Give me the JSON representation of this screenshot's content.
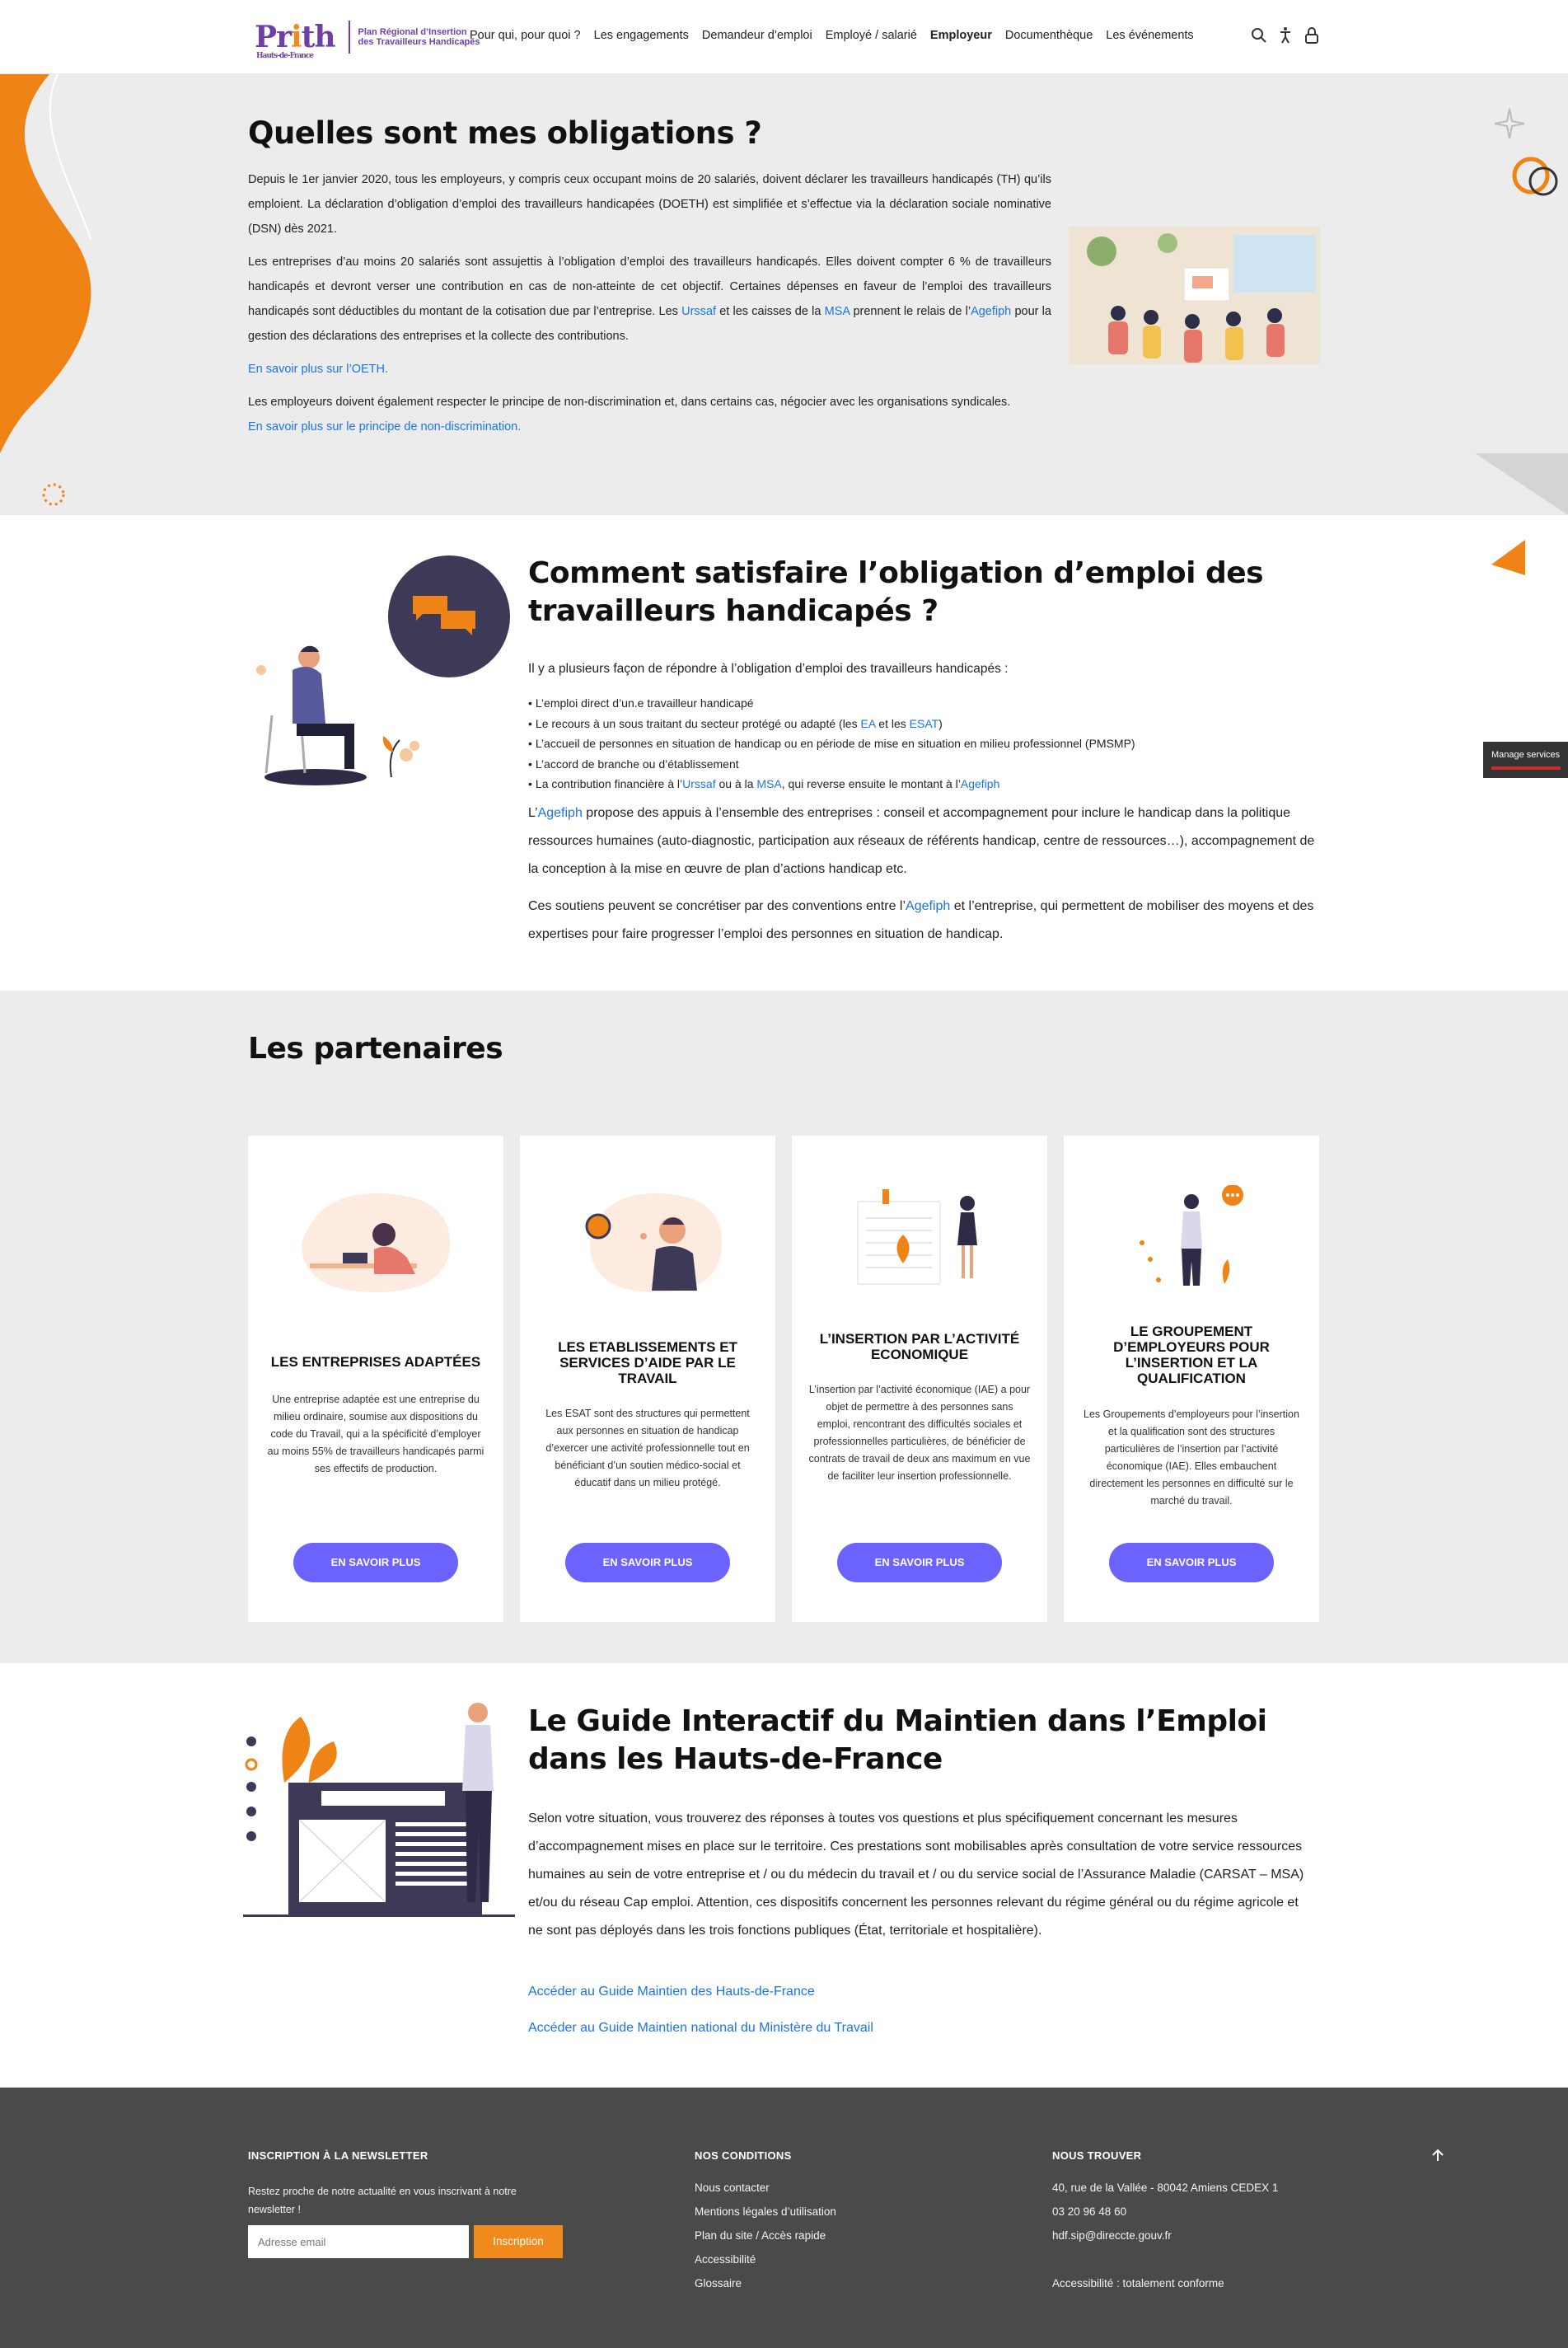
{
  "header": {
    "logo_word_pre": "Pr",
    "logo_word_i": "i",
    "logo_word_post": "th",
    "logo_sub": "Hauts-de-France",
    "logo_text": "Plan Régional d’Insertion des Travailleurs Handicapés",
    "nav": [
      {
        "label": "Pour qui, pour quoi ?"
      },
      {
        "label": "Les engagements"
      },
      {
        "label": "Demandeur d’emploi"
      },
      {
        "label": "Employé / salarié"
      },
      {
        "label": "Employeur"
      },
      {
        "label": "Documenthèque"
      },
      {
        "label": "Les événements"
      }
    ],
    "icons": [
      "search-icon",
      "accessibility-icon",
      "lock-icon"
    ]
  },
  "obligations": {
    "title": "Quelles sont mes obligations ?",
    "p1": "Depuis le 1er janvier 2020, tous les employeurs, y compris ceux occupant moins de 20 salariés, doivent déclarer les travailleurs handicapés (TH) qu’ils emploient. La déclaration d’obligation d’emploi des travailleurs handicapées (DOETH) est simplifiée et s’effectue via la déclaration sociale nominative (DSN) dès 2021.",
    "p2_a": "Les entreprises d’au moins 20 salariés sont assujettis à l’obligation d’emploi des travailleurs handicapés. Elles doivent compter 6 % de travailleurs handicapés et devront verser une contribution en cas de non-atteinte de cet objectif. Certaines dépenses en faveur de l’emploi des travailleurs handicapés sont déductibles du montant de la cotisation due par l’entreprise. Les ",
    "p2_urssaf": "Urssaf",
    "p2_b": " et les caisses de la ",
    "p2_msa": "MSA",
    "p2_c": " prennent le relais de l’",
    "p2_agefiph": "Agefiph",
    "p2_d": " pour la gestion des déclarations des entreprises et la collecte des contributions.",
    "link_oeth": "En savoir plus sur l’OETH.",
    "p3": "Les employeurs doivent également respecter le principe de non-discrimination et, dans certains cas, négocier avec les organisations syndicales.",
    "link_nondiscrim": "En savoir plus sur le principe de non-discrimination."
  },
  "satisfaire": {
    "title": "Comment satisfaire l’obligation d’emploi des travailleurs handicapés ?",
    "intro": "Il y a plusieurs façon de répondre à l’obligation d’emploi des travailleurs handicapés :",
    "li1": "L’emploi direct d’un.e travailleur handicapé",
    "li2_a": "Le recours à un sous traitant du secteur protégé ou adapté (les ",
    "li2_ea": "EA",
    "li2_b": " et les ",
    "li2_esat": "ESAT",
    "li2_c": ")",
    "li3": "L’accueil de personnes en situation de handicap ou en période de mise en situation en milieu professionnel (PMSMP)",
    "li4": "L’accord de branche ou d’établissement",
    "li5_a": "La contribution financière à l’",
    "li5_urssaf": "Urssaf",
    "li5_b": " ou à la ",
    "li5_msa": "MSA",
    "li5_c": ", qui reverse ensuite le montant à l’",
    "li5_agefiph": "Agefiph",
    "para1_a": "L’",
    "para1_agefiph": "Agefiph",
    "para1_b": " propose des appuis à l’ensemble des entreprises : conseil et accompagnement pour inclure le handicap dans la politique ressources humaines (auto-diagnostic, participation aux réseaux de référents handicap, centre de ressources…), accompagnement de la conception à la mise en œuvre de plan d’actions handicap etc.",
    "para2_a": "Ces soutiens peuvent se concrétiser par des conventions entre l’",
    "para2_agefiph": "Agefiph",
    "para2_b": " et l’entreprise, qui permettent de mobiliser des moyens et des expertises pour faire progresser l’emploi des personnes en situation de handicap."
  },
  "partners": {
    "title": "Les partenaires",
    "cards": [
      {
        "title": "LES ENTREPRISES ADAPTÉES",
        "desc": "Une entreprise adaptée est une entreprise du milieu ordinaire, soumise aux dispositions du code du Travail, qui a la spécificité d’employer au moins 55% de travailleurs handicapés parmi ses effectifs de production.",
        "button": "EN SAVOIR PLUS"
      },
      {
        "title": "LES ETABLISSEMENTS ET SERVICES D’AIDE PAR LE TRAVAIL",
        "desc": "Les ESAT sont des structures qui permettent aux personnes en situation de handicap d’exercer une activité professionnelle tout en bénéficiant d’un soutien médico-social et éducatif dans un milieu protégé.",
        "button": "EN SAVOIR PLUS"
      },
      {
        "title": "L’INSERTION PAR L’ACTIVITÉ ECONOMIQUE",
        "desc": "L’insertion par l’activité économique (IAE) a pour objet de permettre à des personnes sans emploi, rencontrant des difficultés sociales et professionnelles particulières, de bénéficier de contrats de travail de deux ans maximum en vue de faciliter leur insertion professionnelle.",
        "button": "EN SAVOIR PLUS"
      },
      {
        "title": "LE GROUPEMENT D’EMPLOYEURS POUR L’INSERTION ET LA QUALIFICATION",
        "desc": "Les Groupements d’employeurs pour l’insertion et la qualification sont des structures particulières de l’insertion par l’activité économique (IAE). Elles embauchent directement les personnes en difficulté sur le marché du travail.",
        "button": "EN SAVOIR PLUS"
      }
    ]
  },
  "guide": {
    "title": "Le Guide Interactif du Maintien dans l’Emploi dans les Hauts-de-France",
    "para": "Selon votre situation, vous trouverez des réponses à toutes vos questions et plus spécifiquement concernant les mesures d’accompagnement mises en place sur le territoire. Ces prestations sont mobilisables après consultation de votre service ressources humaines au sein de votre entreprise et / ou du médecin du travail et / ou du service social de l’Assurance Maladie (CARSAT – MSA) et/ou du réseau Cap emploi. Attention, ces dispositifs concernent les personnes relevant du régime général ou du régime agricole et ne sont pas déployés dans les trois fonctions publiques (État, territoriale et hospitalière).",
    "link1": "Accéder au Guide Maintien des Hauts-de-France",
    "link2": "Accéder au Guide Maintien national du Ministère du Travail"
  },
  "footer": {
    "newsletter_title": "INSCRIPTION À LA NEWSLETTER",
    "newsletter_text": "Restez proche de notre actualité en vous inscrivant à notre newsletter !",
    "newsletter_placeholder": "Adresse email",
    "newsletter_button": "Inscription",
    "conditions_title": "NOS CONDITIONS",
    "conditions_links": [
      "Nous contacter",
      "Mentions légales d’utilisation",
      "Plan du site / Accès rapide",
      "Accessibilité",
      "Glossaire"
    ],
    "find_title": "NOUS TROUVER",
    "address": "40, rue de la Vallée - 80042 Amiens CEDEX 1",
    "phone": "03 20 96 48 60",
    "email": "hdf.sip@direccte.gouv.fr",
    "accessibility": "Accessibilité : totalement conforme"
  },
  "manage_services": "Manage services",
  "colors": {
    "accent": "#f08a1c",
    "purple": "#6f3fa5",
    "button": "#6c63ff",
    "link": "#1a73e8",
    "footer": "#4a4a4a"
  }
}
